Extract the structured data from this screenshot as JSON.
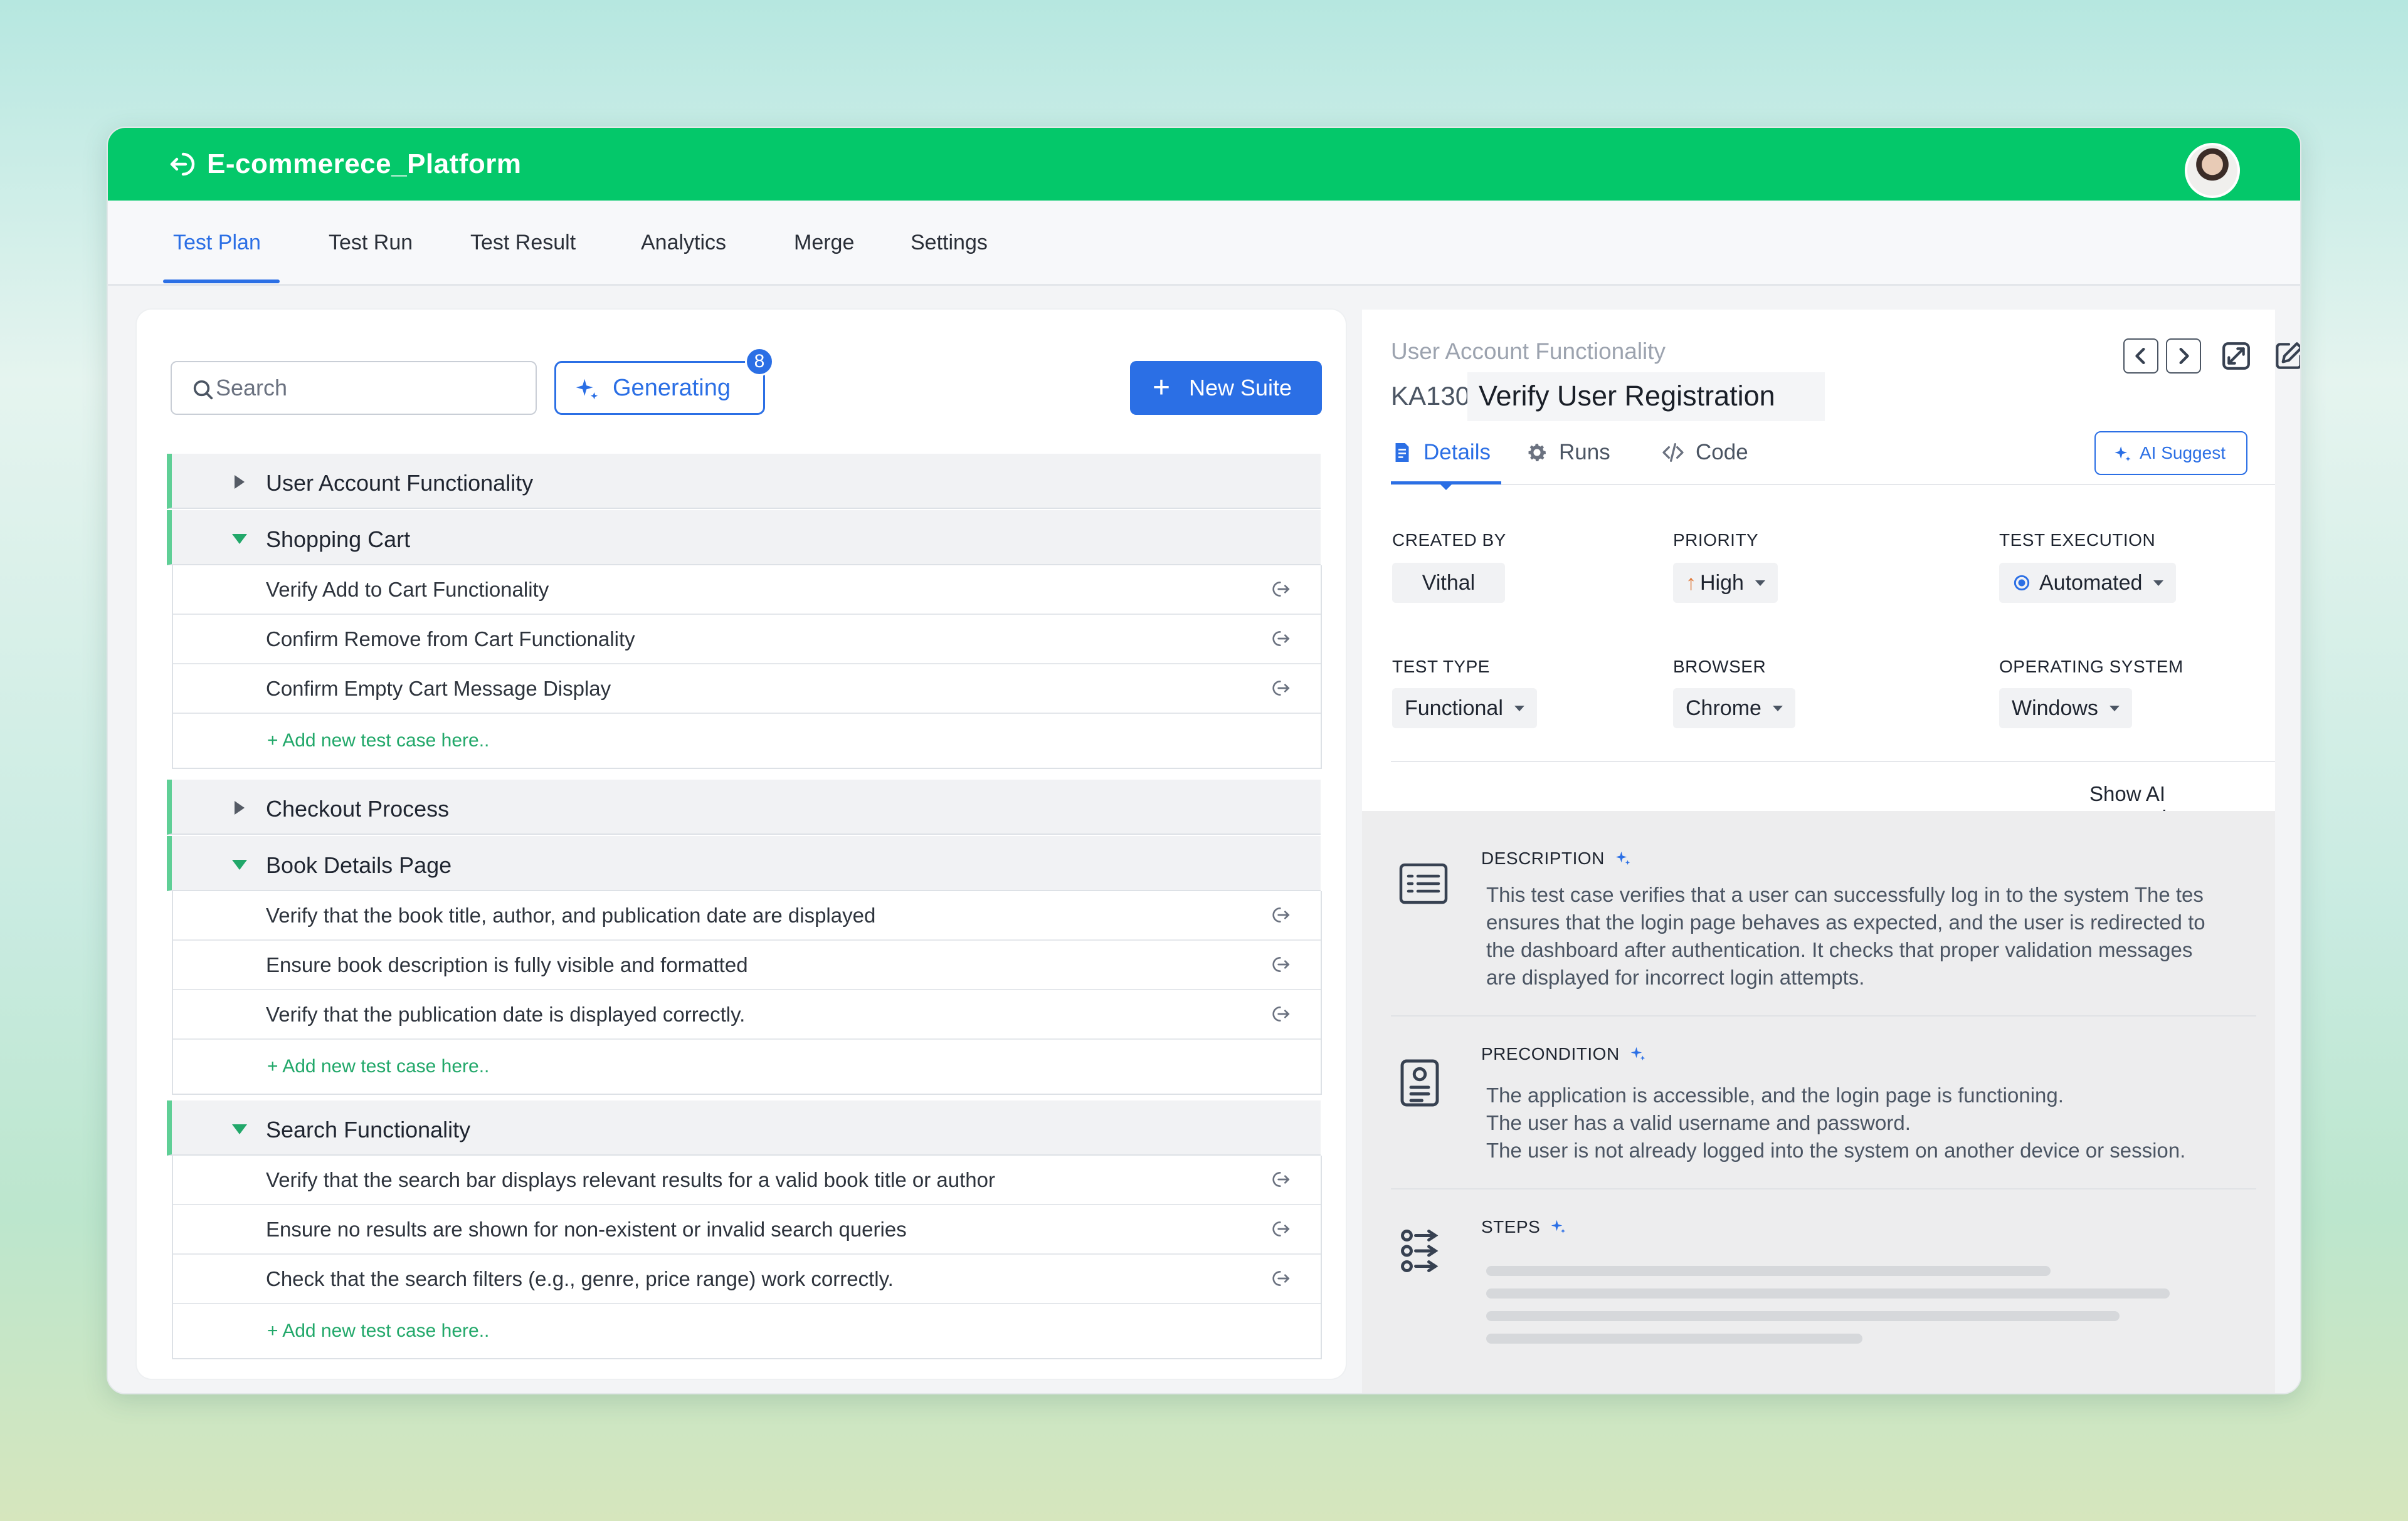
{
  "app": {
    "title": "E-commerece_Platform"
  },
  "nav": {
    "tabs": [
      {
        "label": "Test Plan",
        "active": true
      },
      {
        "label": "Test Run"
      },
      {
        "label": "Test Result"
      },
      {
        "label": "Analytics"
      },
      {
        "label": "Merge"
      },
      {
        "label": "Settings"
      }
    ]
  },
  "toolbar": {
    "search_placeholder": "Search",
    "generating_label": "Generating",
    "generating_count": "8",
    "new_suite_label": "New Suite"
  },
  "suites": [
    {
      "name": "User Account Functionality",
      "expanded": false
    },
    {
      "name": "Shopping Cart",
      "expanded": true,
      "cases": [
        "Verify Add to Cart Functionality",
        "Confirm Remove from Cart Functionality",
        "Confirm Empty Cart Message Display"
      ]
    },
    {
      "name": "Checkout Process",
      "expanded": false
    },
    {
      "name": "Book Details Page",
      "expanded": true,
      "cases": [
        "Verify that the book title, author, and publication date are displayed",
        "Ensure book description is fully visible and formatted",
        "Verify that the publication date is displayed correctly."
      ]
    },
    {
      "name": "Search Functionality",
      "expanded": true,
      "cases": [
        "Verify that the search bar displays relevant results for a valid book title or author",
        "Ensure no results are shown for non-existent or invalid search queries",
        "Check that the search filters (e.g., genre, price range) work correctly."
      ]
    }
  ],
  "add_case_label": "+ Add new test case here..",
  "detail": {
    "breadcrumb": "User Account Functionality",
    "id": "KA130",
    "title": "Verify User Registration",
    "tabs": [
      "Details",
      "Runs",
      "Code"
    ],
    "ai_suggest_label": "AI Suggest",
    "fields": {
      "created_by": {
        "label": "CREATED BY",
        "value": "Vithal"
      },
      "priority": {
        "label": "PRIORITY",
        "value": "High"
      },
      "test_execution": {
        "label": "TEST EXECUTION",
        "value": "Automated"
      },
      "test_type": {
        "label": "TEST TYPE",
        "value": "Functional"
      },
      "browser": {
        "label": "BROWSER",
        "value": "Chrome"
      },
      "os": {
        "label": "OPERATING SYSTEM",
        "value": "Windows"
      }
    },
    "show_ai_label": "Show AI suggestions",
    "show_ai_on": true,
    "description": {
      "title": "DESCRIPTION",
      "lines": [
        "This test case verifies that a user can successfully log in to the system The tes",
        "ensures that the login page behaves as expected, and the user is redirected to",
        "the dashboard after authentication. It checks that proper validation messages",
        "are displayed for incorrect login attempts."
      ]
    },
    "precondition": {
      "title": "PRECONDITION",
      "lines": [
        "The application is accessible, and the login page is functioning.",
        "The user has a valid username and password.",
        "The user is not already logged into the system on another device or session."
      ]
    },
    "steps": {
      "title": "STEPS"
    }
  },
  "colors": {
    "brand": "#04c86a",
    "accent": "#2b6fe5",
    "suite_marker": "#5fcf96",
    "priority_high": "#e07a3b"
  }
}
